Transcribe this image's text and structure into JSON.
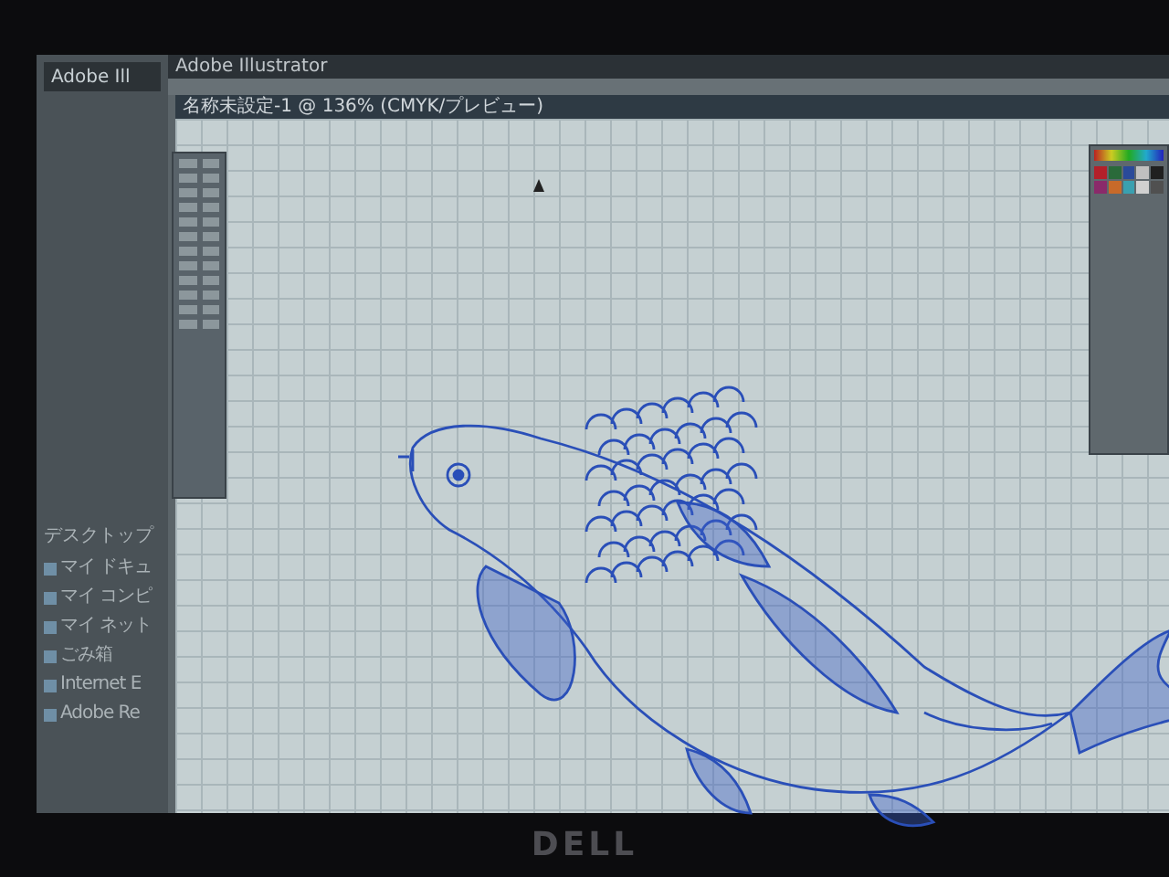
{
  "taskbar": {
    "buttons": [
      {
        "label": "Adobe Ill",
        "selected": true
      }
    ],
    "quick_launch": {
      "title": "デスクトップ",
      "items": [
        {
          "label": "マイ ドキュ"
        },
        {
          "label": "マイ コンピ"
        },
        {
          "label": "マイ ネット"
        },
        {
          "label": "ごみ箱"
        },
        {
          "label": "Internet E"
        },
        {
          "label": "Adobe Re"
        }
      ]
    }
  },
  "window": {
    "title": "Adobe Illustrator"
  },
  "document": {
    "title": "名称未設定-1 @ 136% (CMYK/プレビュー)"
  },
  "monitor": {
    "brand": "DELL"
  }
}
